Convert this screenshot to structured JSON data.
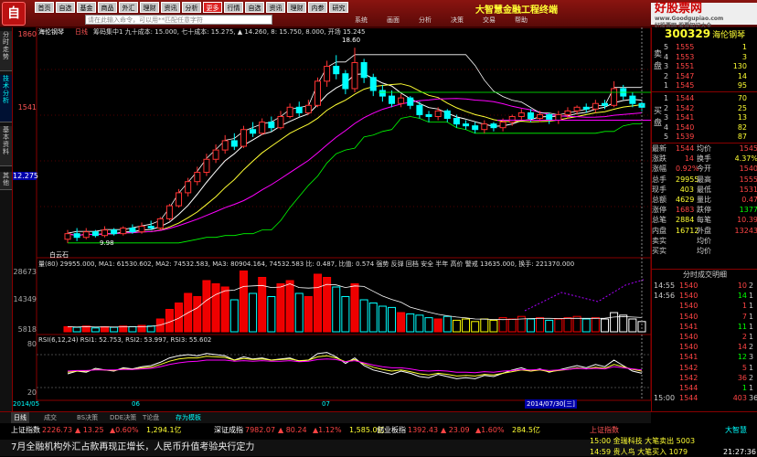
{
  "toolbar": {
    "logo": "自",
    "buttons_row1": [
      "首页",
      "自选",
      "基金",
      "商品",
      "外汇",
      "理财",
      "资讯",
      "分析",
      "更多"
    ],
    "buttons_row2": [
      "行情",
      "自选",
      "资讯",
      "理财",
      "内参",
      "研究"
    ],
    "command_placeholder": "请在此输入命令，可以用**匹配任意字符",
    "menu": [
      "系统",
      "画面",
      "分析",
      "决策",
      "交易",
      "帮助"
    ],
    "app_title": "大智慧金融工程终端",
    "brand_title": "好股票网",
    "brand_sub": "www.Goodgupiao.com",
    "brand_small": "好股票网·股票知识大全"
  },
  "left_tabs": [
    "分时走势",
    "技术分析",
    "基本资料",
    "其他"
  ],
  "chart": {
    "title_code": "海伦钢琴",
    "title_period": "日线",
    "indicator_line": "筹码集中1  九十成本: 15.000, 七十成本: 15.275, ▲ 14.260, 8: 15.750, 8.000, 开场  15.245",
    "price_labels": [
      "1860",
      "1541",
      "12.275"
    ],
    "annotation_top": "18.60",
    "annotation_low": "白云石",
    "low_mark": "9.98",
    "volume_line": "量(80)  29955.000, MA1: 61530.602, MA2: 74532.583, MA3: 80904.164, 74532.583   比: 0.487, 比值: 0.574   强势  反弹  回档  安全  半年  高价  警戒  13635.000, 换手: 221370.000",
    "volume_labels": [
      "28673",
      "14349",
      "5818"
    ],
    "rsi_line": "RSI(6,12,24)  RSI1: 52.753, RSI2: 53.997, RSI3: 55.602",
    "rsi_labels": [
      "80",
      "20"
    ],
    "date_left": "2014/05",
    "date_mid1": "06",
    "date_mid2": "07",
    "date_cursor": "2014/07/30[三]",
    "candles": [
      {
        "o": 8.3,
        "c": 8.6,
        "h": 8.8,
        "l": 8.1
      },
      {
        "o": 8.6,
        "c": 8.4,
        "h": 8.9,
        "l": 8.2
      },
      {
        "o": 8.4,
        "c": 8.7,
        "h": 8.9,
        "l": 8.3
      },
      {
        "o": 8.7,
        "c": 8.5,
        "h": 8.8,
        "l": 8.4
      },
      {
        "o": 8.5,
        "c": 8.8,
        "h": 9.0,
        "l": 8.4
      },
      {
        "o": 8.8,
        "c": 8.6,
        "h": 8.9,
        "l": 8.5
      },
      {
        "o": 8.6,
        "c": 8.9,
        "h": 9.0,
        "l": 8.5
      },
      {
        "o": 8.9,
        "c": 8.7,
        "h": 9.1,
        "l": 8.6
      },
      {
        "o": 8.7,
        "c": 9.0,
        "h": 9.2,
        "l": 8.6
      },
      {
        "o": 9.0,
        "c": 8.9,
        "h": 9.3,
        "l": 8.8
      },
      {
        "o": 8.9,
        "c": 9.4,
        "h": 9.5,
        "l": 8.8
      },
      {
        "o": 9.4,
        "c": 10.1,
        "h": 10.2,
        "l": 9.3
      },
      {
        "o": 10.1,
        "c": 10.8,
        "h": 11.0,
        "l": 10.0
      },
      {
        "o": 10.8,
        "c": 11.4,
        "h": 11.6,
        "l": 10.6
      },
      {
        "o": 11.4,
        "c": 11.9,
        "h": 12.2,
        "l": 11.2
      },
      {
        "o": 11.9,
        "c": 12.6,
        "h": 12.9,
        "l": 11.7
      },
      {
        "o": 12.6,
        "c": 13.1,
        "h": 13.4,
        "l": 12.4
      },
      {
        "o": 13.1,
        "c": 13.6,
        "h": 13.9,
        "l": 12.9
      },
      {
        "o": 13.6,
        "c": 13.3,
        "h": 14.0,
        "l": 13.1
      },
      {
        "o": 13.3,
        "c": 14.2,
        "h": 14.4,
        "l": 13.2
      },
      {
        "o": 14.2,
        "c": 14.0,
        "h": 14.6,
        "l": 13.8
      },
      {
        "o": 14.0,
        "c": 14.6,
        "h": 14.8,
        "l": 13.9
      },
      {
        "o": 14.6,
        "c": 14.3,
        "h": 14.9,
        "l": 14.1
      },
      {
        "o": 14.3,
        "c": 14.9,
        "h": 15.2,
        "l": 14.2
      },
      {
        "o": 14.9,
        "c": 15.4,
        "h": 15.6,
        "l": 14.8
      },
      {
        "o": 15.4,
        "c": 15.1,
        "h": 15.7,
        "l": 14.9
      },
      {
        "o": 15.1,
        "c": 15.5,
        "h": 15.8,
        "l": 15.0
      },
      {
        "o": 15.5,
        "c": 16.8,
        "h": 17.0,
        "l": 15.4
      },
      {
        "o": 16.8,
        "c": 17.6,
        "h": 17.9,
        "l": 16.5
      },
      {
        "o": 17.6,
        "c": 17.2,
        "h": 18.2,
        "l": 16.9
      },
      {
        "o": 17.2,
        "c": 16.4,
        "h": 17.4,
        "l": 16.1
      },
      {
        "o": 16.4,
        "c": 17.8,
        "h": 18.6,
        "l": 16.2
      },
      {
        "o": 17.8,
        "c": 17.0,
        "h": 18.0,
        "l": 16.7
      },
      {
        "o": 17.0,
        "c": 16.3,
        "h": 17.2,
        "l": 16.0
      },
      {
        "o": 16.3,
        "c": 16.0,
        "h": 16.6,
        "l": 15.7
      },
      {
        "o": 16.0,
        "c": 15.6,
        "h": 16.3,
        "l": 15.4
      },
      {
        "o": 15.6,
        "c": 15.9,
        "h": 16.1,
        "l": 15.4
      },
      {
        "o": 15.9,
        "c": 15.5,
        "h": 16.0,
        "l": 15.3
      },
      {
        "o": 15.5,
        "c": 15.0,
        "h": 15.7,
        "l": 14.8
      },
      {
        "o": 15.0,
        "c": 14.9,
        "h": 15.2,
        "l": 14.6
      },
      {
        "o": 14.9,
        "c": 15.2,
        "h": 15.4,
        "l": 14.7
      },
      {
        "o": 15.2,
        "c": 14.8,
        "h": 15.3,
        "l": 14.6
      },
      {
        "o": 14.8,
        "c": 14.5,
        "h": 15.0,
        "l": 14.3
      },
      {
        "o": 14.5,
        "c": 14.4,
        "h": 14.7,
        "l": 14.2
      },
      {
        "o": 14.4,
        "c": 14.2,
        "h": 14.6,
        "l": 14.0
      },
      {
        "o": 14.2,
        "c": 14.5,
        "h": 14.7,
        "l": 14.0
      },
      {
        "o": 14.5,
        "c": 14.3,
        "h": 14.6,
        "l": 14.1
      },
      {
        "o": 14.3,
        "c": 14.6,
        "h": 14.8,
        "l": 14.1
      },
      {
        "o": 14.6,
        "c": 14.9,
        "h": 15.0,
        "l": 14.4
      },
      {
        "o": 14.9,
        "c": 15.1,
        "h": 15.3,
        "l": 14.7
      },
      {
        "o": 15.1,
        "c": 14.8,
        "h": 15.3,
        "l": 14.6
      },
      {
        "o": 14.8,
        "c": 15.0,
        "h": 15.2,
        "l": 14.6
      },
      {
        "o": 15.0,
        "c": 14.7,
        "h": 15.1,
        "l": 14.5
      },
      {
        "o": 14.7,
        "c": 15.0,
        "h": 15.2,
        "l": 14.5
      },
      {
        "o": 15.0,
        "c": 15.2,
        "h": 15.4,
        "l": 14.8
      },
      {
        "o": 15.2,
        "c": 15.4,
        "h": 15.5,
        "l": 15.0
      },
      {
        "o": 15.4,
        "c": 15.3,
        "h": 15.6,
        "l": 15.1
      },
      {
        "o": 15.3,
        "c": 15.6,
        "h": 15.8,
        "l": 15.1
      },
      {
        "o": 15.6,
        "c": 15.5,
        "h": 15.8,
        "l": 15.3
      },
      {
        "o": 15.5,
        "c": 16.4,
        "h": 16.8,
        "l": 15.4
      },
      {
        "o": 16.4,
        "c": 16.0,
        "h": 16.6,
        "l": 15.8
      },
      {
        "o": 16.0,
        "c": 15.6,
        "h": 16.2,
        "l": 15.4
      },
      {
        "o": 15.6,
        "c": 15.4,
        "h": 15.8,
        "l": 15.2
      }
    ],
    "volumes": [
      0.08,
      0.07,
      0.09,
      0.06,
      0.08,
      0.07,
      0.09,
      0.08,
      0.1,
      0.09,
      0.2,
      0.35,
      0.45,
      0.6,
      0.55,
      0.8,
      0.75,
      0.7,
      0.5,
      0.95,
      0.6,
      0.85,
      0.55,
      0.75,
      0.8,
      0.6,
      0.55,
      0.9,
      0.85,
      0.7,
      0.55,
      0.75,
      0.5,
      0.45,
      0.4,
      0.38,
      0.3,
      0.28,
      0.26,
      0.22,
      0.2,
      0.24,
      0.18,
      0.2,
      0.16,
      0.2,
      0.18,
      0.22,
      0.2,
      0.24,
      0.2,
      0.22,
      0.18,
      0.2,
      0.22,
      0.24,
      0.2,
      0.22,
      0.2,
      0.3,
      0.26,
      0.2,
      0.16
    ],
    "rsi1": [
      45,
      50,
      48,
      55,
      52,
      50,
      56,
      54,
      58,
      60,
      66,
      74,
      78,
      80,
      78,
      82,
      80,
      78,
      70,
      76,
      72,
      74,
      70,
      72,
      74,
      68,
      70,
      82,
      84,
      76,
      64,
      74,
      60,
      52,
      48,
      44,
      50,
      46,
      40,
      38,
      44,
      40,
      36,
      38,
      36,
      42,
      40,
      46,
      52,
      56,
      50,
      54,
      48,
      52,
      56,
      60,
      56,
      62,
      58,
      70,
      60,
      50,
      46
    ],
    "rsi2": [
      48,
      50,
      50,
      53,
      52,
      51,
      54,
      53,
      56,
      57,
      62,
      68,
      72,
      74,
      74,
      77,
      76,
      75,
      70,
      73,
      71,
      72,
      70,
      71,
      72,
      69,
      70,
      76,
      78,
      74,
      67,
      71,
      63,
      57,
      53,
      50,
      52,
      49,
      45,
      43,
      46,
      44,
      41,
      42,
      41,
      44,
      43,
      46,
      49,
      52,
      50,
      52,
      49,
      51,
      53,
      56,
      54,
      57,
      55,
      62,
      58,
      53,
      50
    ],
    "rsi3": [
      50,
      51,
      51,
      52,
      52,
      52,
      53,
      53,
      54,
      55,
      58,
      62,
      65,
      67,
      68,
      70,
      70,
      70,
      68,
      69,
      68,
      69,
      68,
      68,
      69,
      67,
      68,
      71,
      72,
      71,
      67,
      69,
      65,
      61,
      58,
      56,
      56,
      54,
      51,
      50,
      51,
      50,
      48,
      48,
      47,
      49,
      48,
      50,
      51,
      53,
      52,
      53,
      51,
      52,
      53,
      55,
      54,
      55,
      54,
      58,
      56,
      54,
      52
    ]
  },
  "quote": {
    "code": "300329",
    "name": "海伦钢琴",
    "sell_side": "卖盘",
    "buy_side": "买盘",
    "asks": [
      {
        "lvl": "5",
        "price": "1555",
        "vol": "1"
      },
      {
        "lvl": "4",
        "price": "1553",
        "vol": "3"
      },
      {
        "lvl": "3",
        "price": "1551",
        "vol": "130"
      },
      {
        "lvl": "2",
        "price": "1547",
        "vol": "14"
      },
      {
        "lvl": "1",
        "price": "1545",
        "vol": "95"
      }
    ],
    "bids": [
      {
        "lvl": "1",
        "price": "1544",
        "vol": "70"
      },
      {
        "lvl": "2",
        "price": "1542",
        "vol": "25"
      },
      {
        "lvl": "3",
        "price": "1541",
        "vol": "13"
      },
      {
        "lvl": "4",
        "price": "1540",
        "vol": "82"
      },
      {
        "lvl": "5",
        "price": "1539",
        "vol": "87"
      }
    ],
    "stats": [
      [
        "最新",
        "1544",
        "均价",
        "1545"
      ],
      [
        "涨跌",
        "14",
        "换手",
        "4.37%"
      ],
      [
        "涨幅",
        "0.92%",
        "今开",
        "1540"
      ],
      [
        "总手",
        "29955",
        "最高",
        "1555"
      ],
      [
        "现手",
        "403",
        "最低",
        "1531"
      ],
      [
        "总额",
        "4629",
        "量比",
        "0.47"
      ],
      [
        "涨停",
        "1683",
        "跌停",
        "1377"
      ],
      [
        "总笔",
        "2884",
        "每笔",
        "10.39"
      ],
      [
        "内盘",
        "16712",
        "外盘",
        "13243"
      ],
      [
        "卖实",
        "",
        "均价",
        ""
      ],
      [
        "买实",
        "",
        "均价",
        ""
      ]
    ],
    "trade_header": "分时成交明细",
    "trades": [
      {
        "t": "14:55",
        "p": "1540",
        "v": "10",
        "k": "2"
      },
      {
        "t": "14:56",
        "p": "1540",
        "v": "14",
        "k": "1"
      },
      {
        "t": "",
        "p": "1540",
        "v": "1",
        "k": "1"
      },
      {
        "t": "",
        "p": "1540",
        "v": "7",
        "k": "1"
      },
      {
        "t": "",
        "p": "1541",
        "v": "11",
        "k": "1"
      },
      {
        "t": "",
        "p": "1540",
        "v": "2",
        "k": "1"
      },
      {
        "t": "",
        "p": "1540",
        "v": "14",
        "k": "2"
      },
      {
        "t": "",
        "p": "1541",
        "v": "12",
        "k": "3"
      },
      {
        "t": "",
        "p": "1542",
        "v": "5",
        "k": "1"
      },
      {
        "t": "",
        "p": "1542",
        "v": "36",
        "k": "2"
      },
      {
        "t": "",
        "p": "1544",
        "v": "1",
        "k": "1"
      },
      {
        "t": "15:00",
        "p": "1544",
        "v": "403",
        "k": "36"
      }
    ]
  },
  "bottom": {
    "tabs": [
      "日线",
      "成交",
      "BS决策",
      "DDE决策",
      "T论盘",
      "存为模板"
    ],
    "ticker": [
      {
        "name": "上证指数",
        "val": "2226.73",
        "chg": "▲ 13.25",
        "pct": "▲0.60%",
        "amt": "1,294.1亿"
      },
      {
        "name": "深证成指",
        "val": "7982.07",
        "chg": "▲ 80.24",
        "pct": "▲1.12%",
        "amt": "1,585.0亿"
      },
      {
        "name": "创业板指",
        "val": "1392.43",
        "chg": "▲ 23.09",
        "pct": "▲1.60%",
        "amt": "284.5亿"
      }
    ],
    "news": "7月全融机构外汇占款再现正增长，人民币升值考验央行定力",
    "clock_lines": [
      "上证指数",
      "15:00 金瑞科技 大笔卖出 5003",
      "14:59 贵人鸟 大笔买入 1079"
    ],
    "clock_time": "21:27:36",
    "clock_brand": "大智慧"
  }
}
